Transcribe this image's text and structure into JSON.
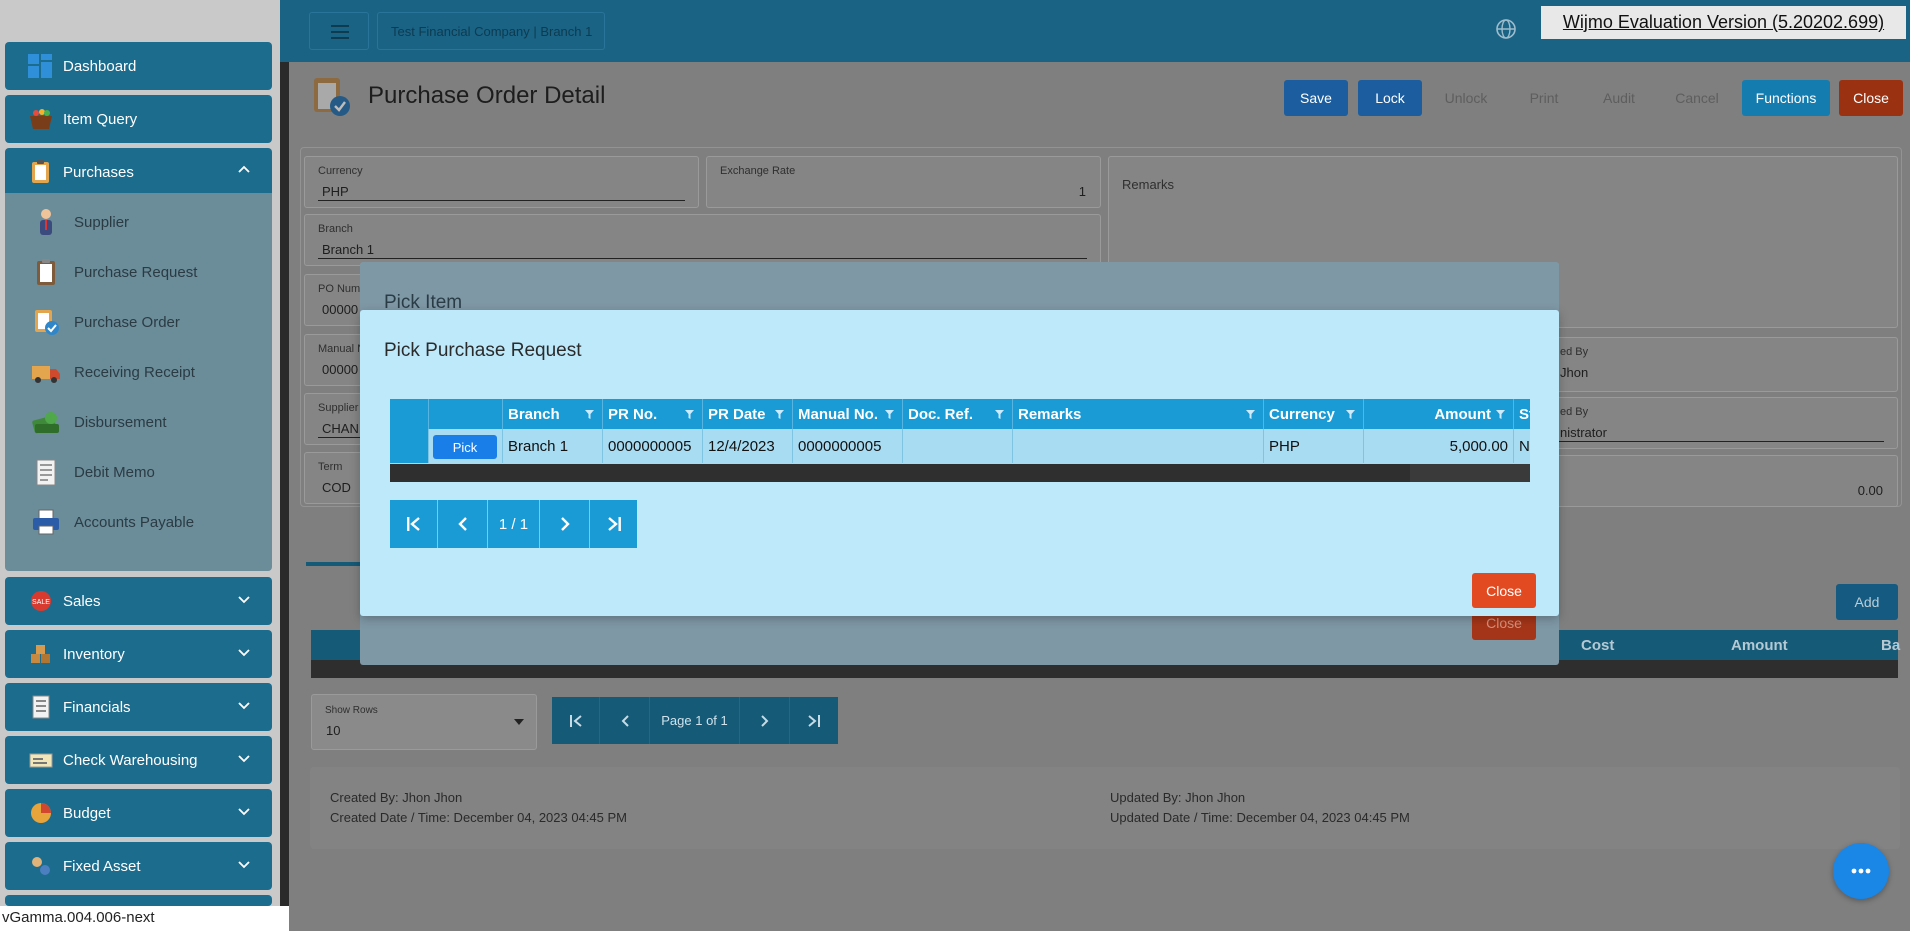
{
  "sidebar": {
    "main_items": [
      {
        "label": "Dashboard",
        "icon": "dashboard-icon"
      },
      {
        "label": "Item Query",
        "icon": "basket-icon"
      },
      {
        "label": "Purchases",
        "icon": "clipboard-icon"
      },
      {
        "label": "Sales",
        "icon": "sales-badge-icon"
      },
      {
        "label": "Inventory",
        "icon": "inventory-icon"
      },
      {
        "label": "Financials",
        "icon": "ledger-icon"
      },
      {
        "label": "Check Warehousing",
        "icon": "check-icon"
      },
      {
        "label": "Budget",
        "icon": "pie-chart-icon"
      },
      {
        "label": "Fixed Asset",
        "icon": "fixed-asset-icon"
      }
    ],
    "purchases_sub_items": [
      {
        "label": "Supplier",
        "icon": "person-icon"
      },
      {
        "label": "Purchase Request",
        "icon": "clipboard-icon"
      },
      {
        "label": "Purchase Order",
        "icon": "order-check-icon"
      },
      {
        "label": "Receiving Receipt",
        "icon": "truck-icon"
      },
      {
        "label": "Disbursement",
        "icon": "money-icon"
      },
      {
        "label": "Debit Memo",
        "icon": "memo-icon"
      },
      {
        "label": "Accounts Payable",
        "icon": "printer-icon"
      }
    ]
  },
  "topbar": {
    "company": "Test Financial Company | Branch 1",
    "evaluation_banner": "Wijmo Evaluation Version (5.20202.699)"
  },
  "page": {
    "title": "Purchase Order Detail",
    "toolbar": {
      "save": "Save",
      "lock": "Lock",
      "unlock": "Unlock",
      "print": "Print",
      "audit": "Audit",
      "cancel": "Cancel",
      "functions": "Functions",
      "close": "Close"
    },
    "fields": {
      "currency_label": "Currency",
      "currency_value": "PHP",
      "exchange_rate_label": "Exchange Rate",
      "exchange_rate_value": "1",
      "branch_label": "Branch",
      "branch_value": "Branch 1",
      "po_number_label": "PO Num",
      "po_number_value": "00000",
      "manual_label": "Manual N",
      "manual_value": "00000",
      "supplier_label": "Supplier",
      "supplier_value": "CHAN",
      "term_label": "Term",
      "term_value": "COD",
      "remarks_label": "Remarks",
      "checked_by_label": "ed By",
      "checked_by_value": "Jhon",
      "approved_by_label": "ed By",
      "approved_by_value": "nistrator",
      "amount_value": "0.00"
    },
    "items_add": "Add",
    "items_columns_partial": [
      "Cost",
      "Amount",
      "Ba"
    ],
    "behind_close": "Close",
    "show_rows_label": "Show Rows",
    "show_rows_value": "10",
    "page_indicator": "Page 1 of 1",
    "footer": {
      "created_by": "Created By: Jhon Jhon",
      "created_date": "Created Date / Time: December 04, 2023 04:45 PM",
      "updated_by": "Updated By: Jhon Jhon",
      "updated_date": "Updated Date / Time: December 04, 2023 04:45 PM"
    }
  },
  "dialog_behind": {
    "title": "Pick Item"
  },
  "dialog": {
    "title": "Pick Purchase Request",
    "columns": [
      "",
      "",
      "Branch",
      "PR No.",
      "PR Date",
      "Manual No.",
      "Doc. Ref.",
      "Remarks",
      "Currency",
      "Amount",
      "St"
    ],
    "row": {
      "pick": "Pick",
      "branch": "Branch 1",
      "pr_no": "0000000005",
      "pr_date": "12/4/2023",
      "manual_no": "0000000005",
      "doc_ref": "",
      "remarks": "",
      "currency": "PHP",
      "amount": "5,000.00",
      "status": "N"
    },
    "pager": "1 / 1",
    "close": "Close"
  },
  "version": "vGamma.004.006-next"
}
